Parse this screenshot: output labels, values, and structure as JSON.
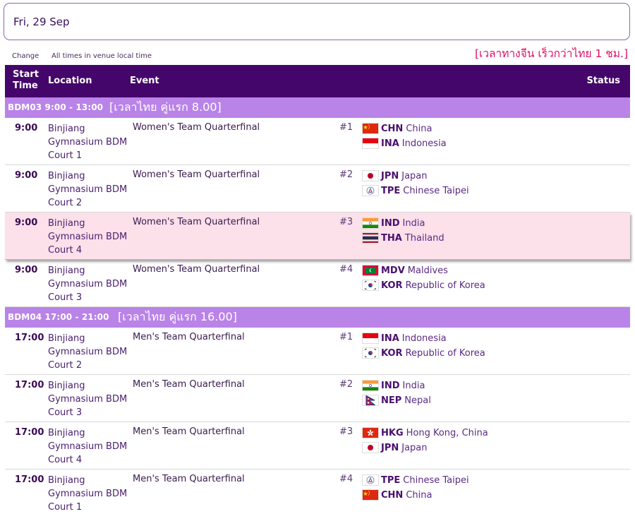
{
  "header": {
    "date": "Fri, 29 Sep",
    "change_label": "Change",
    "timezone_label": "All times in venue local time",
    "note": "[เวลาทางจีน เร็วกว่าไทย 1 ชม.]"
  },
  "columns": {
    "start_time_line1": "Start",
    "start_time_line2": "Time",
    "location": "Location",
    "event": "Event",
    "status": "Status"
  },
  "groups": [
    {
      "code": "BDM03  9:00 - 13:00",
      "thai_note": "[เวลาไทย คู่แรก 8.00]",
      "rows": [
        {
          "time": "9:00",
          "location": "Binjiang Gymnasium BDM Court 1",
          "event": "Women's Team Quarterfinal",
          "num": "#1",
          "team1": {
            "flag": "chn",
            "code": "CHN",
            "name": "China"
          },
          "team2": {
            "flag": "ina",
            "code": "INA",
            "name": "Indonesia"
          }
        },
        {
          "time": "9:00",
          "location": "Binjiang Gymnasium BDM Court 2",
          "event": "Women's Team Quarterfinal",
          "num": "#2",
          "team1": {
            "flag": "jpn",
            "code": "JPN",
            "name": "Japan"
          },
          "team2": {
            "flag": "tpe",
            "code": "TPE",
            "name": "Chinese Taipei"
          }
        },
        {
          "time": "9:00",
          "location": "Binjiang Gymnasium BDM Court 4",
          "event": "Women's Team Quarterfinal",
          "num": "#3",
          "team1": {
            "flag": "ind",
            "code": "IND",
            "name": "India"
          },
          "team2": {
            "flag": "tha",
            "code": "THA",
            "name": "Thailand"
          }
        },
        {
          "time": "9:00",
          "location": "Binjiang Gymnasium BDM Court 3",
          "event": "Women's Team Quarterfinal",
          "num": "#4",
          "team1": {
            "flag": "mdv",
            "code": "MDV",
            "name": "Maldives"
          },
          "team2": {
            "flag": "kor",
            "code": "KOR",
            "name": "Republic of Korea"
          }
        }
      ]
    },
    {
      "code": "BDM04  17:00 - 21:00",
      "thai_note": "[เวลาไทย คู่แรก 16.00]",
      "rows": [
        {
          "time": "17:00",
          "location": "Binjiang Gymnasium BDM Court 2",
          "event": "Men's Team Quarterfinal",
          "num": "#1",
          "team1": {
            "flag": "ina",
            "code": "INA",
            "name": "Indonesia"
          },
          "team2": {
            "flag": "kor",
            "code": "KOR",
            "name": "Republic of Korea"
          }
        },
        {
          "time": "17:00",
          "location": "Binjiang Gymnasium BDM Court 3",
          "event": "Men's Team Quarterfinal",
          "num": "#2",
          "team1": {
            "flag": "ind",
            "code": "IND",
            "name": "India"
          },
          "team2": {
            "flag": "nep",
            "code": "NEP",
            "name": "Nepal"
          }
        },
        {
          "time": "17:00",
          "location": "Binjiang Gymnasium BDM Court 4",
          "event": "Men's Team Quarterfinal",
          "num": "#3",
          "team1": {
            "flag": "hkg",
            "code": "HKG",
            "name": "Hong Kong, China"
          },
          "team2": {
            "flag": "jpn",
            "code": "JPN",
            "name": "Japan"
          }
        },
        {
          "time": "17:00",
          "location": "Binjiang Gymnasium BDM Court 1",
          "event": "Men's Team Quarterfinal",
          "num": "#4",
          "team1": {
            "flag": "tpe",
            "code": "TPE",
            "name": "Chinese Taipei"
          },
          "team2": {
            "flag": "chn",
            "code": "CHN",
            "name": "China"
          }
        }
      ]
    }
  ],
  "highlighted_row": "0.2",
  "colors": {
    "header_bg": "#45066b",
    "group_bg": "#b983e8",
    "highlight_bg": "#fce0ea",
    "note_color": "#e0106a",
    "text_primary": "#4a0f6e"
  }
}
